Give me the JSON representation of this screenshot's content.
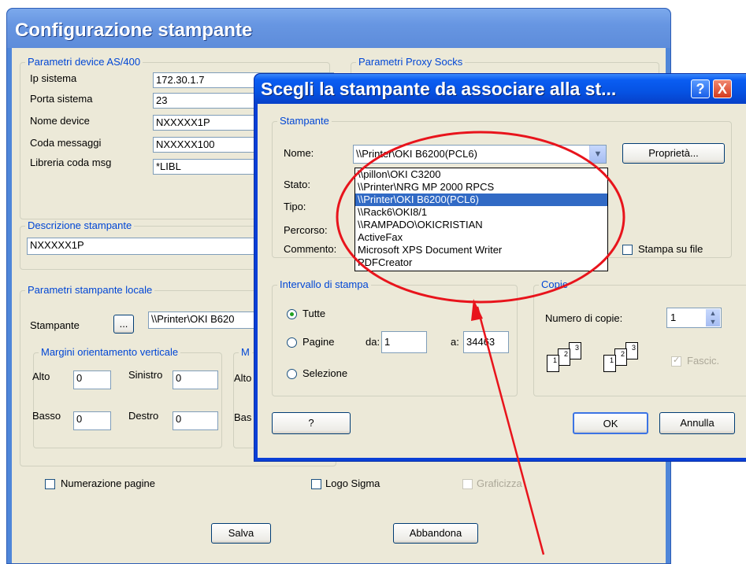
{
  "main_window": {
    "title": "Configurazione stampante",
    "device_group": {
      "legend": "Parametri device AS/400",
      "fields": [
        {
          "label": "Ip sistema",
          "value": "172.30.1.7"
        },
        {
          "label": "Porta sistema",
          "value": "23"
        },
        {
          "label": "Nome device",
          "value": "NXXXXX1P"
        },
        {
          "label": "Coda messaggi",
          "value": "NXXXXX100"
        },
        {
          "label": "Libreria coda msg",
          "value": "*LIBL"
        }
      ]
    },
    "proxy_group": {
      "legend": "Parametri Proxy Socks"
    },
    "description_group": {
      "legend": "Descrizione stampante",
      "value": "NXXXXX1P"
    },
    "local_group": {
      "legend": "Parametri stampante locale",
      "printer_label": "Stampante",
      "browse_label": "...",
      "printer_value": "\\\\Printer\\OKI B620",
      "vertical_margins": {
        "legend": "Margini orientamento verticale",
        "alto_label": "Alto",
        "alto_value": "0",
        "sinistro_label": "Sinistro",
        "sinistro_value": "0",
        "basso_label": "Basso",
        "basso_value": "0",
        "destro_label": "Destro",
        "destro_value": "0"
      },
      "horizontal_margins": {
        "legend": "M",
        "alto_label": "Alto",
        "basso_label": "Bas"
      }
    },
    "numerazione_label": "Numerazione pagine",
    "logo_label": "Logo Sigma",
    "graficizza_label": "Graficizza",
    "save_label": "Salva",
    "cancel_label": "Abbandona"
  },
  "print_dialog": {
    "title": "Scegli la stampante da associare alla st...",
    "help_btn": "?",
    "close_btn": "X",
    "printer_group": {
      "legend": "Stampante",
      "name_label": "Nome:",
      "name_value": "\\\\Printer\\OKI B6200(PCL6)",
      "properties_label": "Proprietà...",
      "stato_label": "Stato:",
      "tipo_label": "Tipo:",
      "percorso_label": "Percorso:",
      "commento_label": "Commento:",
      "print_to_file_label": "Stampa su file"
    },
    "dropdown_options": [
      "\\\\pillon\\OKI C3200",
      "\\\\Printer\\NRG MP 2000 RPCS",
      "\\\\Printer\\OKI B6200(PCL6)",
      "\\\\Rack6\\OKI8/1",
      "\\\\RAMPADO\\OKICRISTIAN",
      "ActiveFax",
      "Microsoft XPS Document Writer",
      "PDFCreator"
    ],
    "selected_option_index": 2,
    "range_group": {
      "legend": "Intervallo di stampa",
      "all_label": "Tutte",
      "pages_label": "Pagine",
      "from_label": "da:",
      "from_value": "1",
      "to_label": "a:",
      "to_value": "34463",
      "selection_label": "Selezione"
    },
    "copies_group": {
      "legend": "Copie",
      "count_label": "Numero di copie:",
      "count_value": "1",
      "collate_label": "Fascic.",
      "page_nums": [
        "1",
        "2",
        "3"
      ]
    },
    "help_button_label": "?",
    "ok_label": "OK",
    "cancel_label": "Annulla"
  },
  "colors": {
    "annotation": "#e8141c",
    "selection": "#316ac5",
    "xp_title": "#0a5df2"
  }
}
